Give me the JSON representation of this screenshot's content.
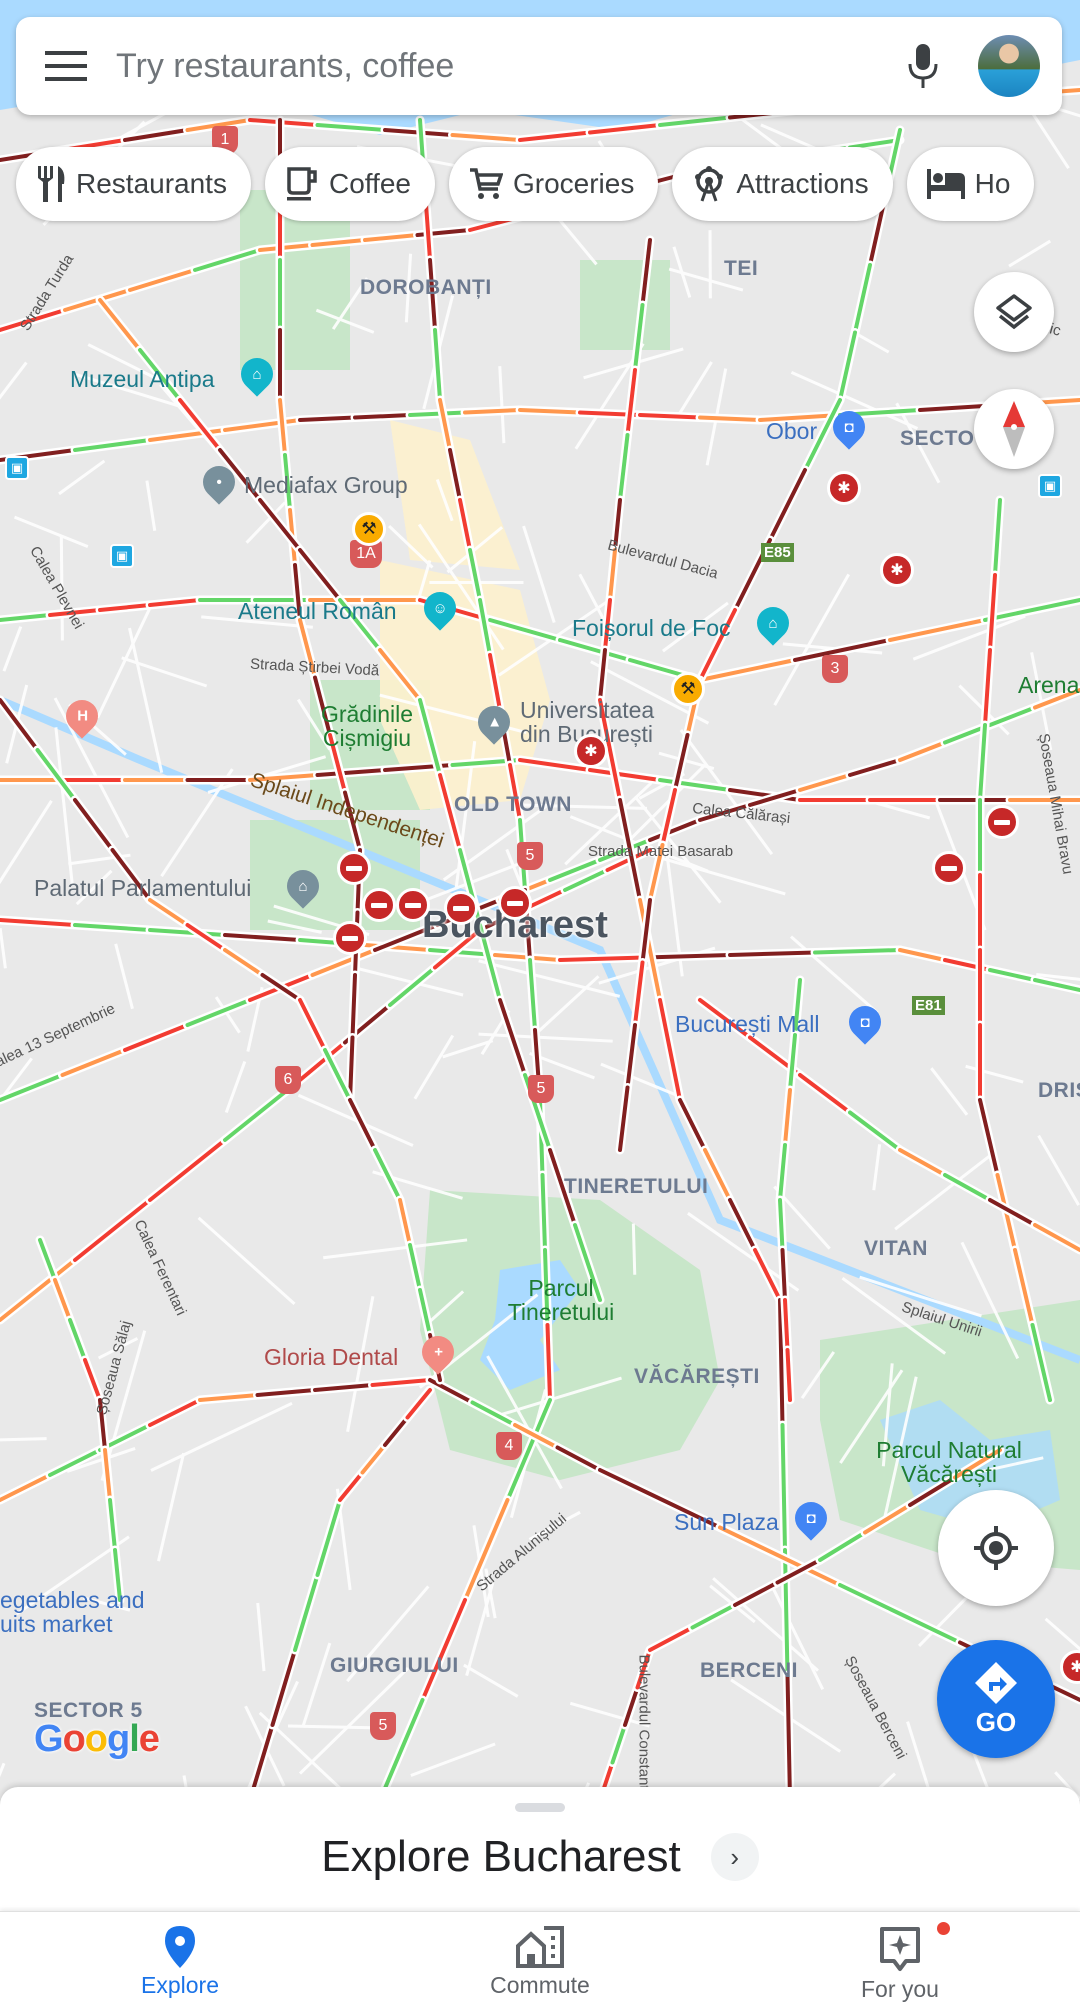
{
  "search": {
    "placeholder": "Try restaurants, coffee",
    "menu_icon": "hamburger-menu-icon",
    "mic_icon": "microphone-icon",
    "avatar": "user-avatar"
  },
  "chips": [
    {
      "label": "Restaurants",
      "icon": "fork-knife-icon"
    },
    {
      "label": "Coffee",
      "icon": "coffee-cup-icon"
    },
    {
      "label": "Groceries",
      "icon": "shopping-cart-icon"
    },
    {
      "label": "Attractions",
      "icon": "ferris-wheel-icon"
    },
    {
      "label": "Ho",
      "icon": "bed-icon"
    }
  ],
  "map": {
    "city": "Bucharest",
    "layer": "traffic",
    "colors": {
      "fast": "#63d668",
      "moderate": "#ff974d",
      "slow": "#f23c32",
      "heavy": "#811f1f",
      "water": "#aadaff",
      "park": "#c8e6c9"
    },
    "districts": [
      "DOROBANȚI",
      "TEI",
      "SECTO",
      "OLD TOWN",
      "TINERETULUI",
      "VITAN",
      "VĂCĂREȘTI",
      "GIURGIULUI",
      "BERCENI",
      "DRIS",
      "SECTOR 5"
    ],
    "pois": [
      {
        "name": "Muzeul Antipa",
        "type": "museum"
      },
      {
        "name": "Mediafax Group",
        "type": "place"
      },
      {
        "name": "Ateneul Român",
        "type": "theater"
      },
      {
        "name": "Foișorul de Foc",
        "type": "museum"
      },
      {
        "name": "Obor",
        "type": "shopping"
      },
      {
        "name": "Grădinile Cișmigiu",
        "type": "park"
      },
      {
        "name": "Universitatea din București",
        "type": "university"
      },
      {
        "name": "Palatul Parlamentului",
        "type": "landmark"
      },
      {
        "name": "București Mall",
        "type": "shopping"
      },
      {
        "name": "Arena",
        "type": "park"
      },
      {
        "name": "Parcul Tineretului",
        "type": "park"
      },
      {
        "name": "Gloria Dental",
        "type": "dental"
      },
      {
        "name": "Parcul Natural Văcărești",
        "type": "park"
      },
      {
        "name": "Sun Plaza",
        "type": "shopping"
      },
      {
        "name": "egetables and uits market",
        "type": "market"
      }
    ],
    "streets": [
      "Strada Turda",
      "Bulevardul Dacia",
      "Calea Plevnei",
      "Strada Știrbei Vodă",
      "Splaiul Independenței",
      "Calea Călărași",
      "Strada Matei Basarab",
      "Șoseaua Mihai Bravu",
      "Calea 13 Septembrie",
      "Calea Ferentari",
      "Șoseaua Sălaj",
      "Splaiul Unirii",
      "Strada Alunișului",
      "Bulevardul Constantin",
      "Șoseaua Berceni",
      "Strada",
      "Ghic"
    ],
    "route_shields": [
      "1",
      "1A",
      "5",
      "5",
      "5",
      "3",
      "6",
      "4",
      "5"
    ],
    "e_routes": [
      "E85",
      "E81"
    ],
    "google_logo": "Google"
  },
  "controls": {
    "layers": "layers-icon",
    "compass": "compass-icon",
    "my_location": "my-location-icon",
    "go_label": "GO"
  },
  "sheet": {
    "title": "Explore Bucharest",
    "arrow": "›"
  },
  "nav": [
    {
      "label": "Explore",
      "icon": "explore-pin-icon",
      "active": true
    },
    {
      "label": "Commute",
      "icon": "commute-icon",
      "active": false
    },
    {
      "label": "For you",
      "icon": "for-you-icon",
      "active": false,
      "badge": true
    }
  ]
}
